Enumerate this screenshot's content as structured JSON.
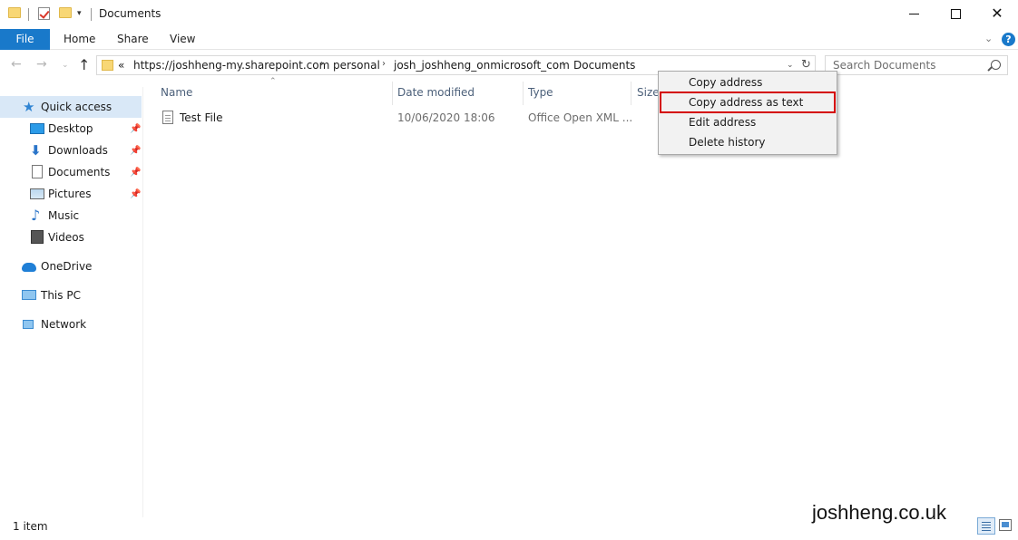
{
  "window": {
    "title": "Documents",
    "qa_dropdown": "▾",
    "minimize": "",
    "maximize": "",
    "close": "✕"
  },
  "ribbon": {
    "tabs": [
      {
        "label": "File"
      },
      {
        "label": "Home"
      },
      {
        "label": "Share"
      },
      {
        "label": "View"
      }
    ],
    "collapse": "⌄",
    "help": "?"
  },
  "nav": {
    "back": "←",
    "forward": "→",
    "recent": "⌄",
    "up": "↑"
  },
  "address": {
    "overflow": "«",
    "crumbs": [
      "https://joshheng-my.sharepoint.com",
      "personal",
      "josh_joshheng_onmicrosoft_com",
      "Documents"
    ],
    "separator": "›",
    "dropdown": "⌄",
    "refresh": "↻"
  },
  "search": {
    "placeholder": "Search Documents"
  },
  "sidebar": {
    "items": [
      {
        "label": "Quick access",
        "icon": "star-icon"
      },
      {
        "label": "Desktop",
        "icon": "desktop-icon",
        "pinned": true
      },
      {
        "label": "Downloads",
        "icon": "download-icon",
        "pinned": true
      },
      {
        "label": "Documents",
        "icon": "documents-icon",
        "pinned": true
      },
      {
        "label": "Pictures",
        "icon": "pictures-icon",
        "pinned": true
      },
      {
        "label": "Music",
        "icon": "music-icon"
      },
      {
        "label": "Videos",
        "icon": "videos-icon"
      },
      {
        "label": "OneDrive",
        "icon": "onedrive-icon"
      },
      {
        "label": "This PC",
        "icon": "this-pc-icon"
      },
      {
        "label": "Network",
        "icon": "network-icon"
      }
    ],
    "pin_glyph": "📌",
    "star_glyph": "★",
    "download_glyph": "⬇",
    "music_glyph": "♪"
  },
  "table": {
    "columns": [
      "Name",
      "Date modified",
      "Type",
      "Size"
    ],
    "sort_indicator": "⌃",
    "rows": [
      {
        "name": "Test File",
        "date": "10/06/2020 18:06",
        "type": "Office Open XML ..."
      }
    ]
  },
  "context_menu": {
    "items": [
      {
        "label": "Copy address"
      },
      {
        "label": "Copy address as text"
      },
      {
        "label": "Edit address"
      },
      {
        "label": "Delete history"
      }
    ],
    "highlighted_index": 1
  },
  "status": {
    "count": "1 item"
  },
  "watermark": "joshheng.co.uk",
  "colors": {
    "file_tab": "#1979ca",
    "selection": "#d9e8f7",
    "highlight_border": "#d40000"
  }
}
